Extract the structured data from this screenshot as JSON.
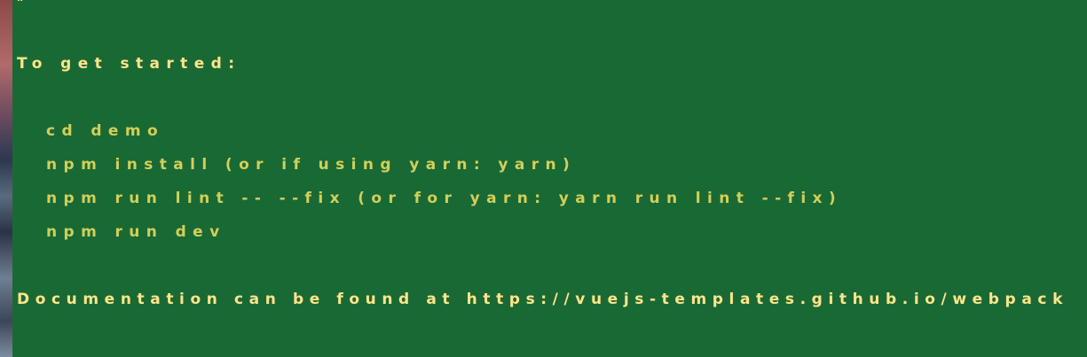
{
  "terminal": {
    "top_rule": "#  ===================================",
    "heading": "To get started:",
    "commands": [
      "cd demo",
      "npm install (or if using yarn: yarn)",
      "npm run lint -- --fix (or for yarn: yarn run lint --fix)",
      "npm run dev"
    ],
    "documentation": "Documentation can be found at https://vuejs-templates.github.io/webpack"
  },
  "colors": {
    "background": "#196935",
    "heading_text": "#ffe58a",
    "command_text": "#d2cf59"
  }
}
